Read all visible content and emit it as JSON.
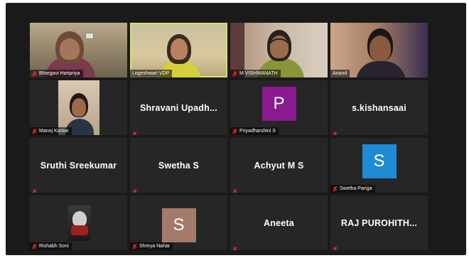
{
  "participants": [
    {
      "name": "Bhargavi Haripriya",
      "video": true,
      "muted": true
    },
    {
      "name": "Logeshwari VDP",
      "video": true,
      "muted": false,
      "active_speaker": true
    },
    {
      "name": "M VISHWANATH",
      "video": true,
      "muted": true
    },
    {
      "name": "Anand",
      "video": true,
      "muted": false
    },
    {
      "name": "Manoj Kumar",
      "video": true,
      "muted": true
    },
    {
      "display": "Shravani  Upadh...",
      "muted": true
    },
    {
      "name": "Priyadharshini S",
      "avatar_letter": "P",
      "avatar_color": "#8a1a8e",
      "muted": true
    },
    {
      "display": "s.kishansaai",
      "muted": true
    },
    {
      "display": "Sruthi Sreekumar",
      "muted": true
    },
    {
      "display": "Swetha S",
      "muted": true
    },
    {
      "display": "Achyut M S",
      "muted": true
    },
    {
      "name": "Swetha Pariga",
      "avatar_letter": "S",
      "avatar_color": "#1f8bd6",
      "muted": true
    },
    {
      "name": "Rishabh Soni",
      "video": true,
      "muted": true
    },
    {
      "name": "Shreya Nahar",
      "avatar_letter": "S",
      "avatar_color": "#a47a6b",
      "muted": true
    },
    {
      "display": "Aneeta",
      "muted": true
    },
    {
      "display": "RAJ  PUROHITH...",
      "muted": true
    }
  ],
  "icons": {
    "mic_muted": "mic-muted-icon"
  },
  "colors": {
    "active_border": "#d6e06a",
    "tile_bg": "#262626",
    "muted_red": "#e02828"
  }
}
